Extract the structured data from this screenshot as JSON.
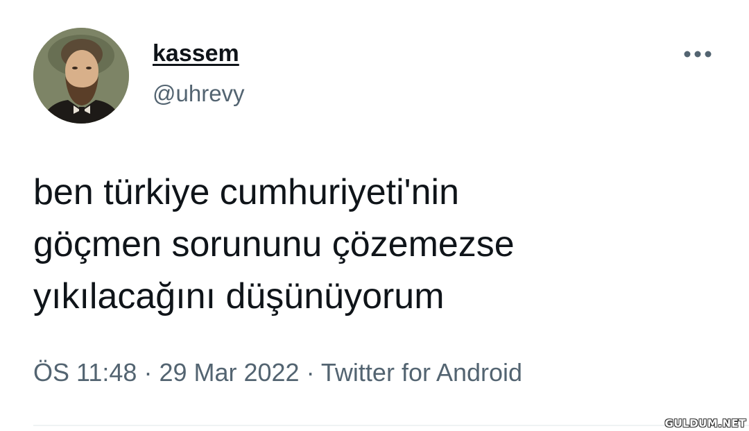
{
  "user": {
    "display_name": "kassem",
    "handle": "@uhrevy"
  },
  "tweet": {
    "lines": [
      "ben türkiye cumhuriyeti'nin",
      "göçmen sorununu çözemezse",
      "yıkılacağını düşünüyorum"
    ]
  },
  "meta": {
    "time": "ÖS 11:48",
    "separator": " · ",
    "date": "29 Mar 2022",
    "source": "Twitter for Android"
  },
  "icons": {
    "more": "more-horizontal-icon"
  },
  "watermark": "GULDUM.NET"
}
